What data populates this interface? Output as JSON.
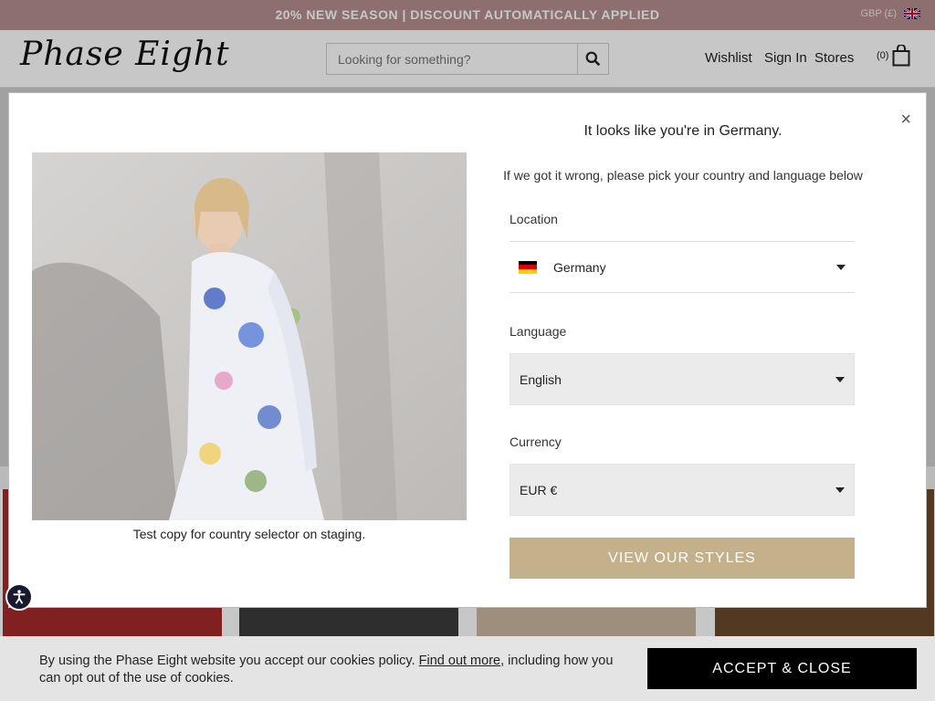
{
  "promo": {
    "text": "20% NEW SEASON | DISCOUNT AUTOMATICALLY APPLIED",
    "currency": "GBP (£)"
  },
  "header": {
    "logo": "Phase Eight",
    "search_placeholder": "Looking for something?",
    "nav": {
      "wishlist": "Wishlist",
      "signin": "Sign In",
      "stores": "Stores"
    },
    "bag_count": "(0)"
  },
  "modal": {
    "heading": "It looks like you're in Germany.",
    "subheading": "If we got it wrong, please pick your country and language below",
    "caption": "Test copy for country selector on staging.",
    "location_label": "Location",
    "location_value": "Germany",
    "language_label": "Language",
    "language_value": "English",
    "currency_label": "Currency",
    "currency_value": "EUR €",
    "cta": "VIEW OUR STYLES",
    "close": "×"
  },
  "cookie": {
    "text_before": "By using the Phase Eight website you accept our cookies policy. ",
    "link": "Find out more",
    "text_after": ", including how you can opt out of the use of cookies.",
    "button": "ACCEPT & CLOSE"
  },
  "colors": {
    "promo_bg": "#b58f8f",
    "cta_bg": "#c4b08a",
    "cookie_btn_bg": "#000000"
  }
}
